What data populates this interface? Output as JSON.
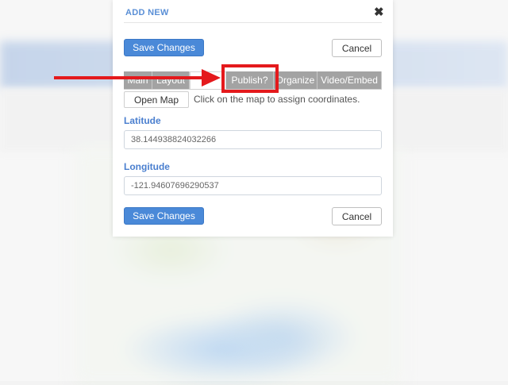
{
  "modal": {
    "title": "ADD NEW",
    "close_icon": "close-icon"
  },
  "toolbar": {
    "save_label": "Save Changes",
    "cancel_label": "Cancel"
  },
  "tabs": [
    {
      "label": "Main"
    },
    {
      "label": "Layout"
    },
    {
      "label": ""
    },
    {
      "label": "Publish?"
    },
    {
      "label": "Organize"
    },
    {
      "label": "Video/Embed"
    }
  ],
  "map": {
    "open_button": "Open Map",
    "hint": "Click on the map to assign coordinates."
  },
  "latitude": {
    "label": "Latitude",
    "value": "38.144938824032266"
  },
  "longitude": {
    "label": "Longitude",
    "value": "-121.94607696290537"
  },
  "footer": {
    "save_label": "Save Changes",
    "cancel_label": "Cancel"
  },
  "colors": {
    "accent": "#4a89d8",
    "annotation": "#e4191c",
    "label": "#4a7fcf"
  }
}
